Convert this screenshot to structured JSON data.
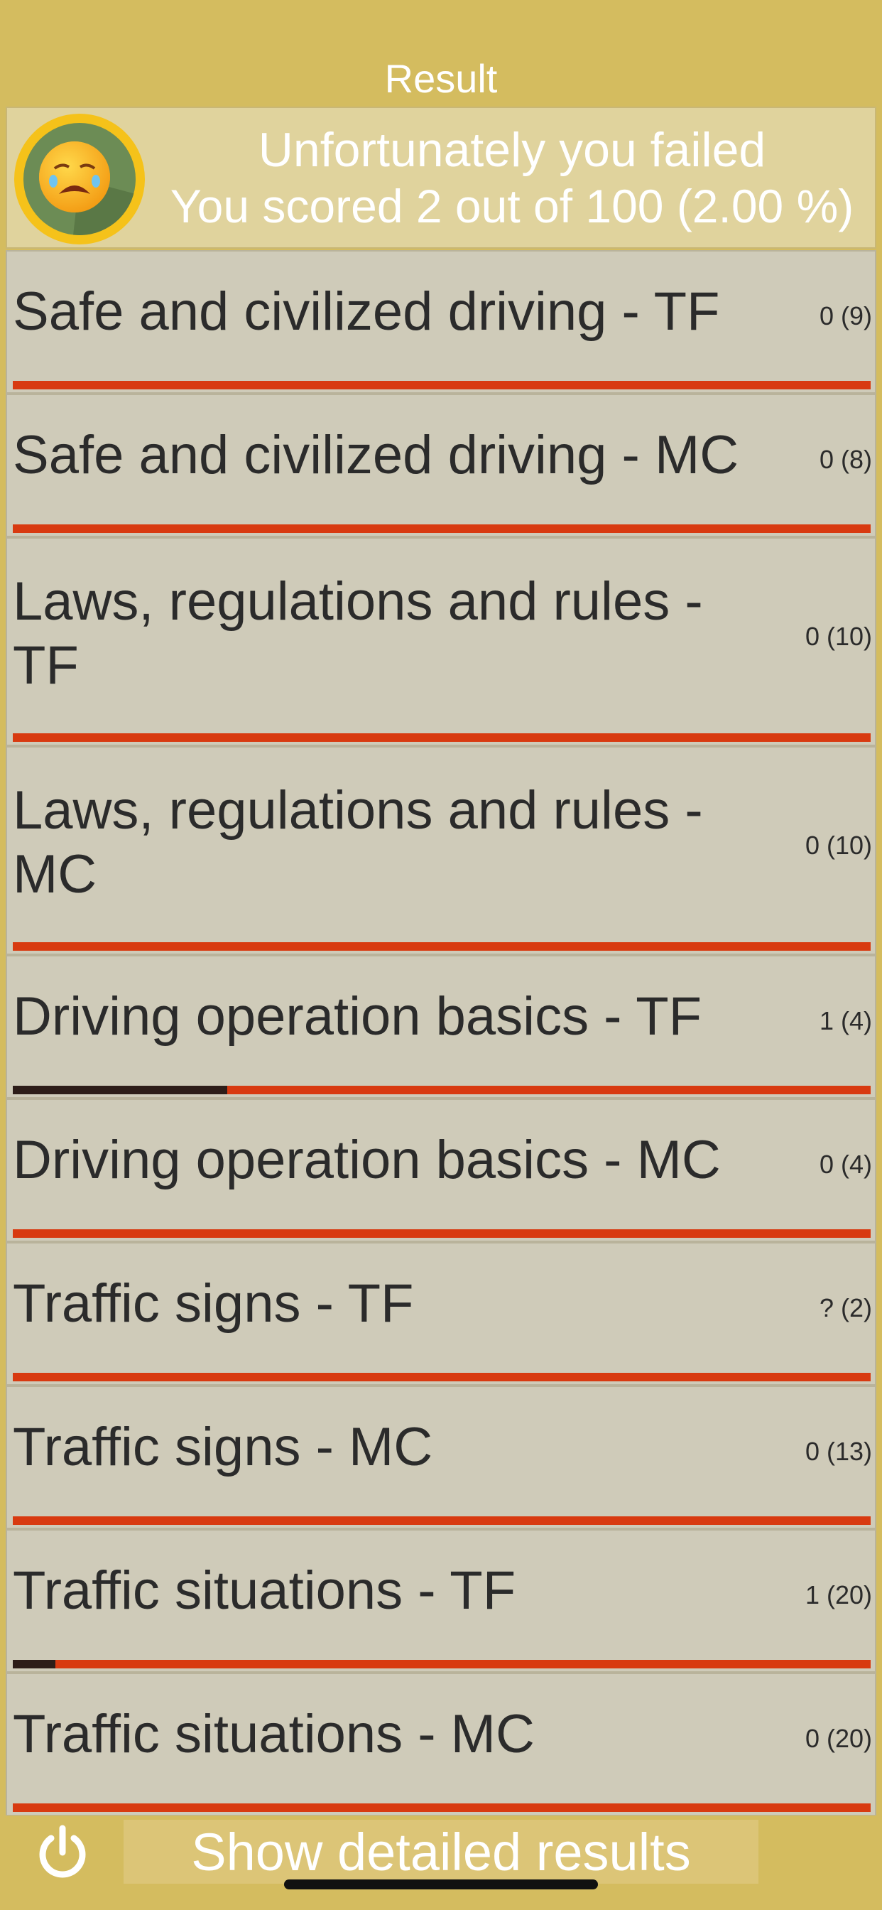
{
  "header": {
    "title": "Result"
  },
  "summary": {
    "line1": "Unfortunately you failed",
    "line2": "You scored 2 out of 100 (2.00 %)",
    "avatar_icon": "crying-face-icon"
  },
  "categories": [
    {
      "label": "Safe and civilized driving - TF",
      "score": "0 (9)",
      "progress": 0
    },
    {
      "label": "Safe and civilized driving - MC",
      "score": "0 (8)",
      "progress": 0
    },
    {
      "label": "Laws, regulations and rules - TF",
      "score": "0 (10)",
      "progress": 0
    },
    {
      "label": "Laws, regulations and rules - MC",
      "score": "0 (10)",
      "progress": 0
    },
    {
      "label": "Driving operation basics - TF",
      "score": "1 (4)",
      "progress": 0.25
    },
    {
      "label": "Driving operation basics - MC",
      "score": "0 (4)",
      "progress": 0
    },
    {
      "label": "Traffic signs - TF",
      "score": "? (2)",
      "progress": 0
    },
    {
      "label": "Traffic signs - MC",
      "score": "0 (13)",
      "progress": 0
    },
    {
      "label": "Traffic situations - TF",
      "score": "1 (20)",
      "progress": 0.05
    },
    {
      "label": "Traffic situations - MC",
      "score": "0 (20)",
      "progress": 0
    }
  ],
  "bottom": {
    "power_icon": "power-icon",
    "details_label": "Show detailed results"
  },
  "colors": {
    "accent": "#d4bc5f",
    "progress_fail": "#d83a10",
    "progress_pass": "#2d1d18"
  }
}
